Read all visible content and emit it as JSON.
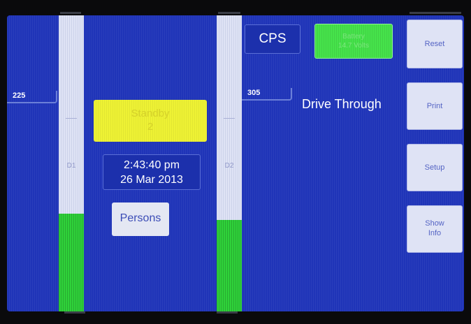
{
  "sensors": [
    {
      "id": "D1",
      "value": "225",
      "fill_fraction": 0.33
    },
    {
      "id": "D2",
      "value": "305",
      "fill_fraction": 0.31
    }
  ],
  "status": {
    "line1": "Standby",
    "line2": "2",
    "color": "#eef234"
  },
  "clock": {
    "time": "2:43:40 pm",
    "date": "26 Mar 2013"
  },
  "persons_button": {
    "label": "Persons"
  },
  "cps": {
    "label": "CPS"
  },
  "battery": {
    "line1": "Battery",
    "line2": "14.7 Volts",
    "color": "#46e34b"
  },
  "mode_text": "Drive Through",
  "side_buttons": {
    "reset": "Reset",
    "print": "Print",
    "setup": "Setup",
    "show_info_line1": "Show",
    "show_info_line2": "Info"
  },
  "colors": {
    "screen": "#1f34b8",
    "sensor_active": "#2fd23a"
  }
}
